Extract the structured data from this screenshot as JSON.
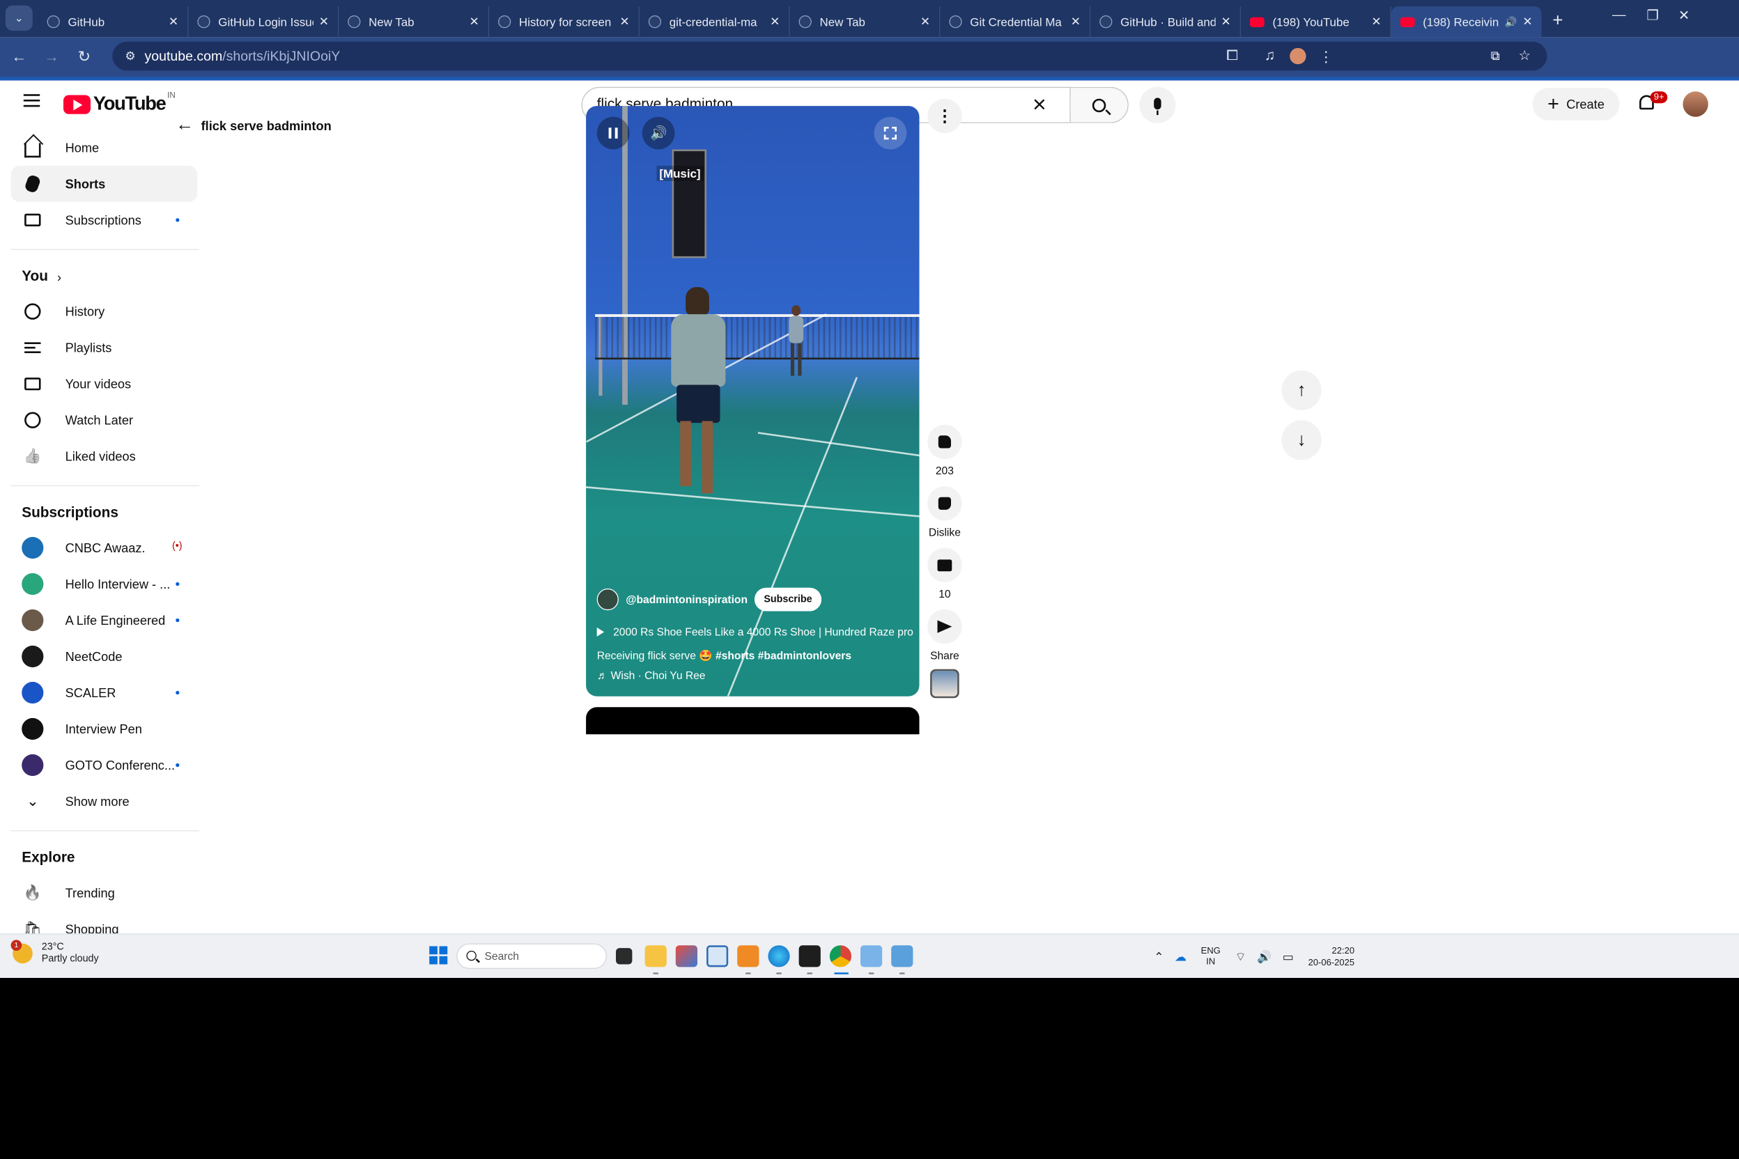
{
  "browser": {
    "tabs": [
      {
        "title": "GitHub",
        "icon": "github-icon",
        "active": false
      },
      {
        "title": "GitHub Login Issue",
        "icon": "github-icon",
        "active": false
      },
      {
        "title": "New Tab",
        "icon": "chrome-icon",
        "active": false
      },
      {
        "title": "History for screen",
        "icon": "github-icon",
        "active": false
      },
      {
        "title": "git-credential-ma",
        "icon": "github-icon",
        "active": false
      },
      {
        "title": "New Tab",
        "icon": "chrome-icon",
        "active": false
      },
      {
        "title": "Git Credential Ma",
        "icon": "github-icon",
        "active": false
      },
      {
        "title": "GitHub · Build and",
        "icon": "github-icon",
        "active": false
      },
      {
        "title": "(198) YouTube",
        "icon": "youtube-icon",
        "active": false
      },
      {
        "title": "(198) Receivin",
        "icon": "youtube-icon",
        "active": true
      }
    ],
    "new_tab_label": "+",
    "url_host": "youtube.com",
    "url_path": "/shorts/iKbjJNIOoiY"
  },
  "youtube": {
    "logo_text": "YouTube",
    "logo_country": "IN",
    "search_value": "flick serve badminton",
    "create_label": "Create",
    "notification_count": "9+"
  },
  "sidebar": {
    "main": [
      {
        "label": "Home",
        "icon": "home-icon"
      },
      {
        "label": "Shorts",
        "icon": "shorts-icon",
        "active": true
      },
      {
        "label": "Subscriptions",
        "icon": "subscriptions-icon",
        "dot": true
      }
    ],
    "you_label": "You",
    "you": [
      {
        "label": "History",
        "icon": "history-icon"
      },
      {
        "label": "Playlists",
        "icon": "playlists-icon"
      },
      {
        "label": "Your videos",
        "icon": "your-videos-icon"
      },
      {
        "label": "Watch Later",
        "icon": "watch-later-icon"
      },
      {
        "label": "Liked videos",
        "icon": "liked-videos-icon"
      }
    ],
    "subscriptions_heading": "Subscriptions",
    "subscriptions": [
      {
        "label": "CNBC Awaaz.",
        "live": "(•)",
        "color": "#1a6fb5"
      },
      {
        "label": "Hello Interview - ...",
        "dot": true,
        "color": "#2aa67c"
      },
      {
        "label": "A Life Engineered",
        "dot": true,
        "color": "#6b5a4a"
      },
      {
        "label": "NeetCode",
        "dot": false,
        "color": "#1a1a1a"
      },
      {
        "label": "SCALER",
        "dot": true,
        "color": "#1a55c7"
      },
      {
        "label": "Interview Pen",
        "dot": false,
        "color": "#111111"
      },
      {
        "label": "GOTO Conferenc...",
        "dot": true,
        "color": "#3b2a6b"
      }
    ],
    "show_more_label": "Show more",
    "explore_heading": "Explore",
    "explore": [
      {
        "label": "Trending",
        "icon": "trending-icon"
      },
      {
        "label": "Shopping",
        "icon": "shopping-icon"
      }
    ]
  },
  "shorts": {
    "back_label": "flick serve badminton",
    "caption": "[Music]",
    "channel": "@badmintoninspiration",
    "subscribe_label": "Subscribe",
    "related_video": "2000 Rs Shoe Feels Like a 4000 Rs Shoe | Hundred Raze pro",
    "title_text": "Receiving flick serve 🤩",
    "title_tags": "#shorts #badmintonlovers",
    "music": "♬ Wish · Choi Yu Ree",
    "likes": "203",
    "dislike_label": "Dislike",
    "comments": "10",
    "share_label": "Share"
  },
  "taskbar": {
    "weather_temp": "23°C",
    "weather_desc": "Partly cloudy",
    "weather_badge": "1",
    "search_placeholder": "Search",
    "lang_top": "ENG",
    "lang_bottom": "IN",
    "time": "22:20",
    "date": "20-06-2025"
  }
}
